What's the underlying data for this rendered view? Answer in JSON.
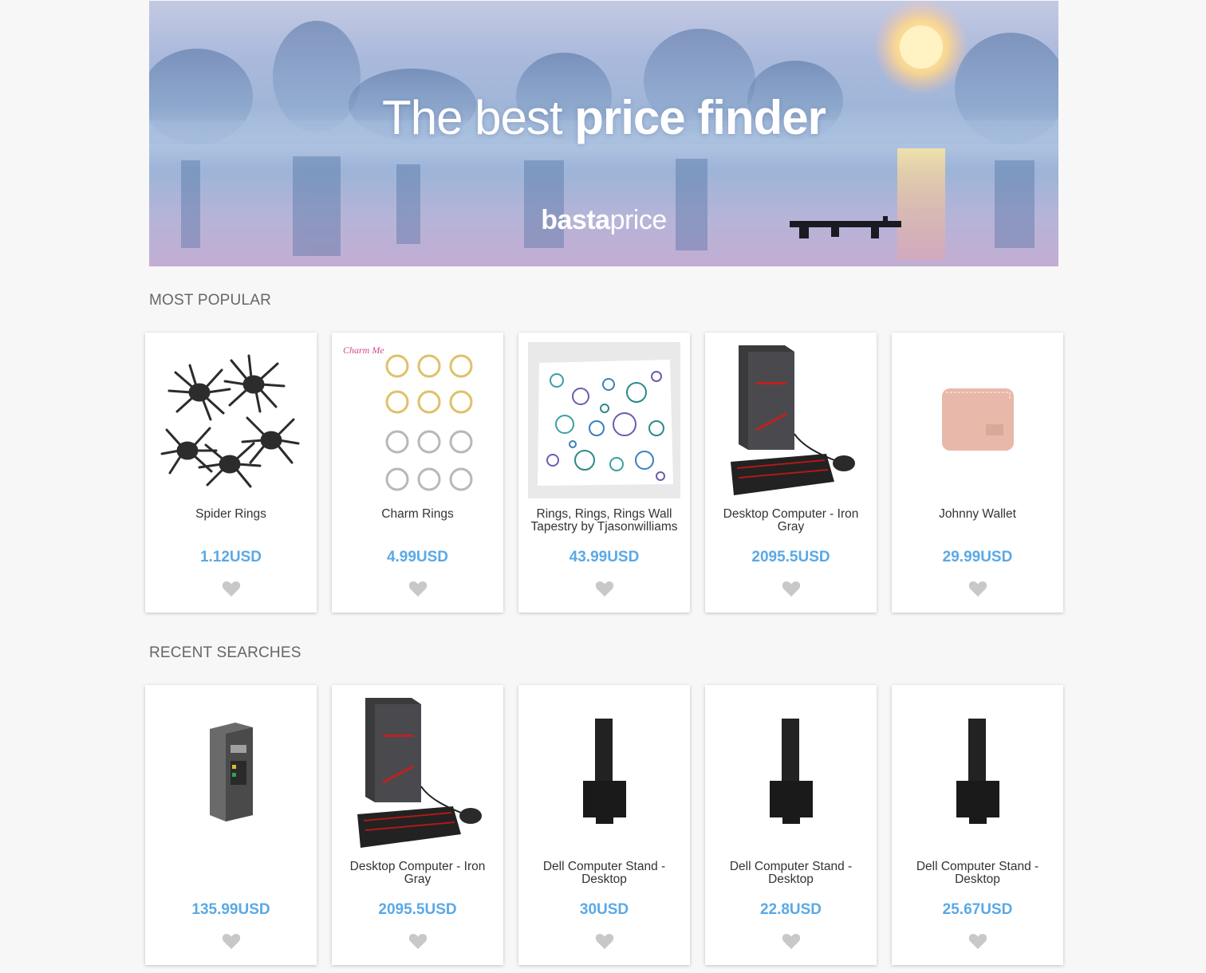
{
  "banner": {
    "title_light": "The best",
    "title_bold": "price finder",
    "logo_bold": "basta",
    "logo_regular": "price"
  },
  "most_popular": {
    "title": "MOST POPULAR",
    "items": [
      {
        "name": "Spider Rings",
        "price": "1.12USD"
      },
      {
        "name": "Charm Rings",
        "price": "4.99USD",
        "image_text": "Charm Me"
      },
      {
        "name": "Rings, Rings, Rings Wall Tapestry by Tjasonwilliams",
        "price": "43.99USD"
      },
      {
        "name": "Desktop Computer - Iron Gray",
        "price": "2095.5USD"
      },
      {
        "name": "Johnny Wallet",
        "price": "29.99USD"
      }
    ]
  },
  "recent_searches": {
    "title": "RECENT SEARCHES",
    "items": [
      {
        "name": "",
        "price": "135.99USD"
      },
      {
        "name": "Desktop Computer - Iron Gray",
        "price": "2095.5USD"
      },
      {
        "name": "Dell Computer Stand - Desktop",
        "price": "30USD"
      },
      {
        "name": "Dell Computer Stand - Desktop",
        "price": "22.8USD"
      },
      {
        "name": "Dell Computer Stand - Desktop",
        "price": "25.67USD"
      }
    ]
  },
  "colors": {
    "price": "#5aa9e6",
    "heart": "#c8c8c8",
    "background": "#f7f7f7"
  }
}
